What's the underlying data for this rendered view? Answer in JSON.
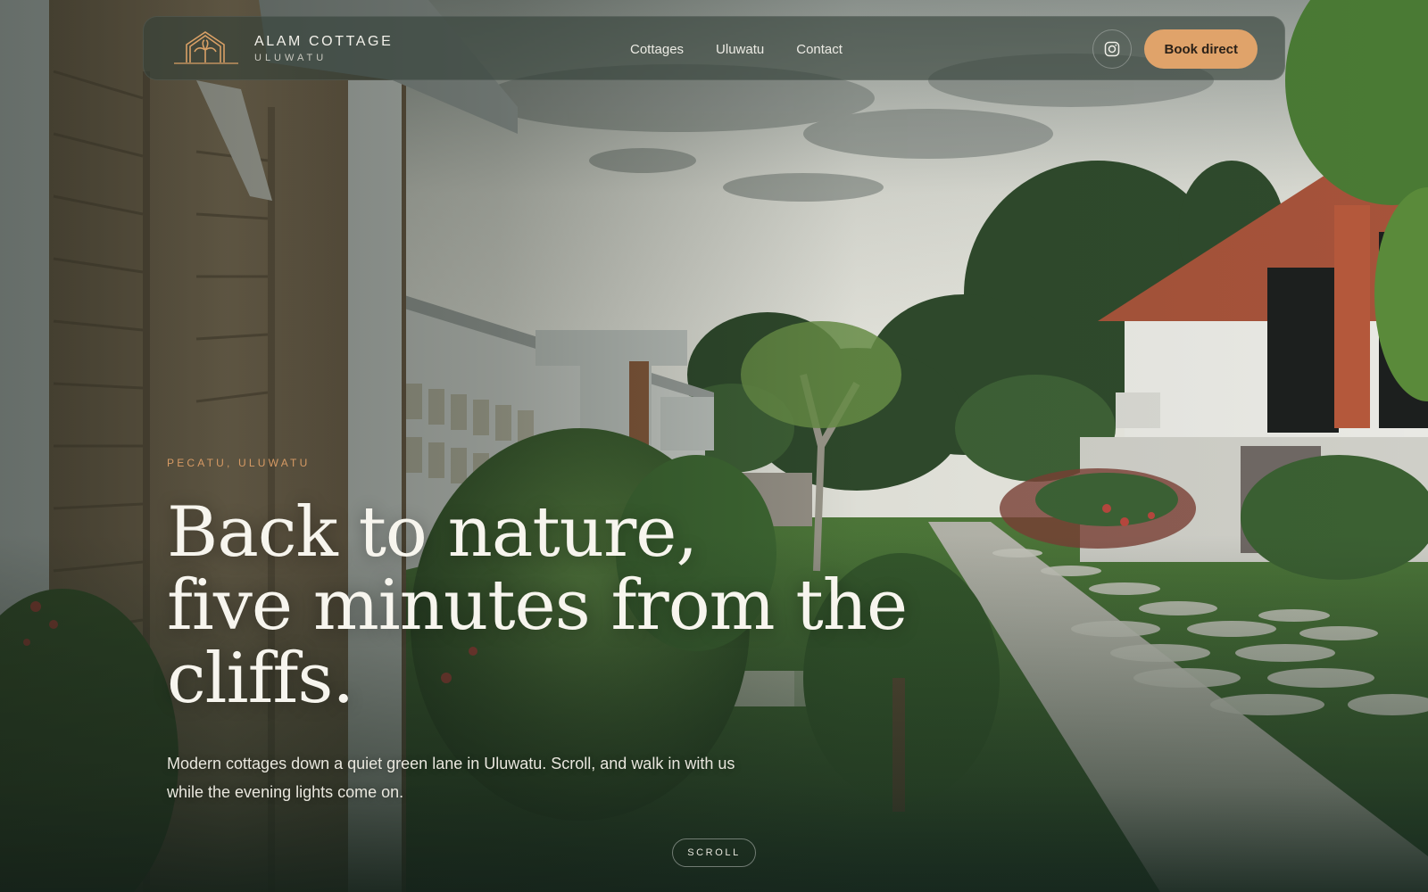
{
  "brand": {
    "name": "ALAM COTTAGE",
    "subtitle": "ULUWATU",
    "logo_icon": "cottage-palm-logo"
  },
  "nav": {
    "links": [
      {
        "label": "Cottages"
      },
      {
        "label": "Uluwatu"
      },
      {
        "label": "Contact"
      }
    ],
    "instagram_icon": "instagram-icon",
    "book_label": "Book direct"
  },
  "hero": {
    "eyebrow": "PECATU, ULUWATU",
    "headline_lines": [
      "Back to nature,",
      "five minutes from the",
      "cliffs."
    ],
    "lede": "Modern cottages down a quiet green lane in Uluwatu. Scroll, and walk in with us while the evening lights come on.",
    "scroll_label": "SCROLL"
  },
  "colors": {
    "accent": "#e0a36a",
    "eyebrow": "#d69a64",
    "nav_bg": "#344038"
  }
}
